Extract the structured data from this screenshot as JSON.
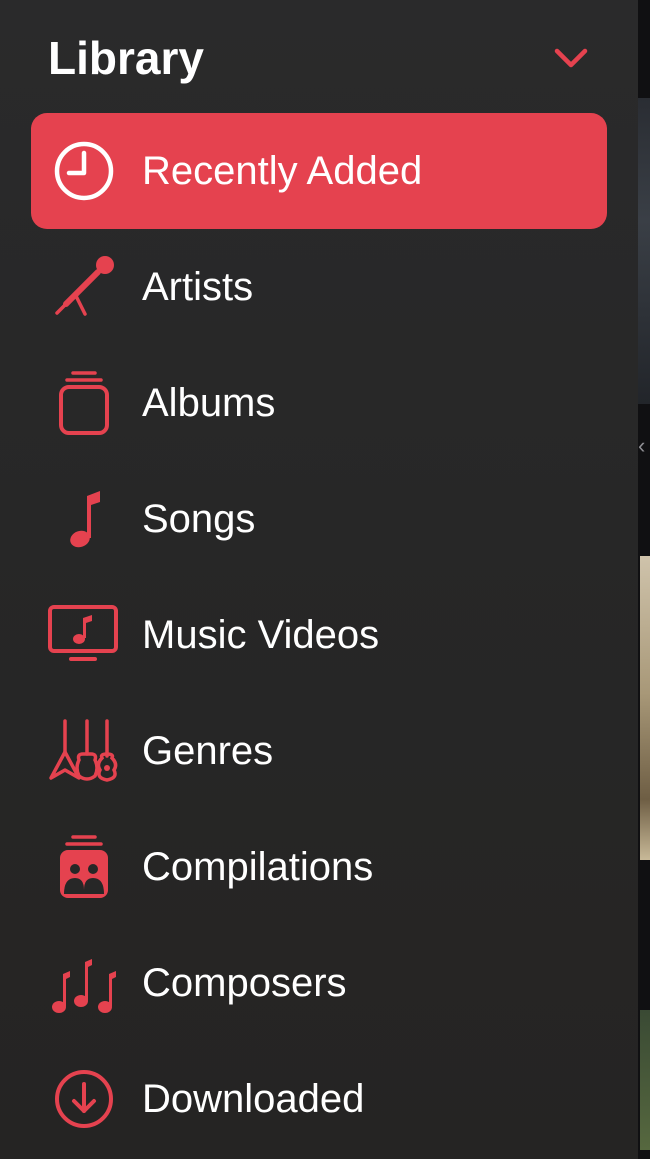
{
  "sidebar": {
    "title": "Library",
    "collapse_icon": "chevron-down-icon",
    "accent_color": "#e5424f",
    "items": [
      {
        "label": "Recently Added",
        "icon": "clock-icon",
        "selected": true
      },
      {
        "label": "Artists",
        "icon": "microphone-icon",
        "selected": false
      },
      {
        "label": "Albums",
        "icon": "album-stack-icon",
        "selected": false
      },
      {
        "label": "Songs",
        "icon": "music-note-icon",
        "selected": false
      },
      {
        "label": "Music Videos",
        "icon": "music-video-icon",
        "selected": false
      },
      {
        "label": "Genres",
        "icon": "guitars-icon",
        "selected": false
      },
      {
        "label": "Compilations",
        "icon": "compilation-icon",
        "selected": false
      },
      {
        "label": "Composers",
        "icon": "music-notes-icon",
        "selected": false
      },
      {
        "label": "Downloaded",
        "icon": "download-circle-icon",
        "selected": false
      }
    ]
  }
}
